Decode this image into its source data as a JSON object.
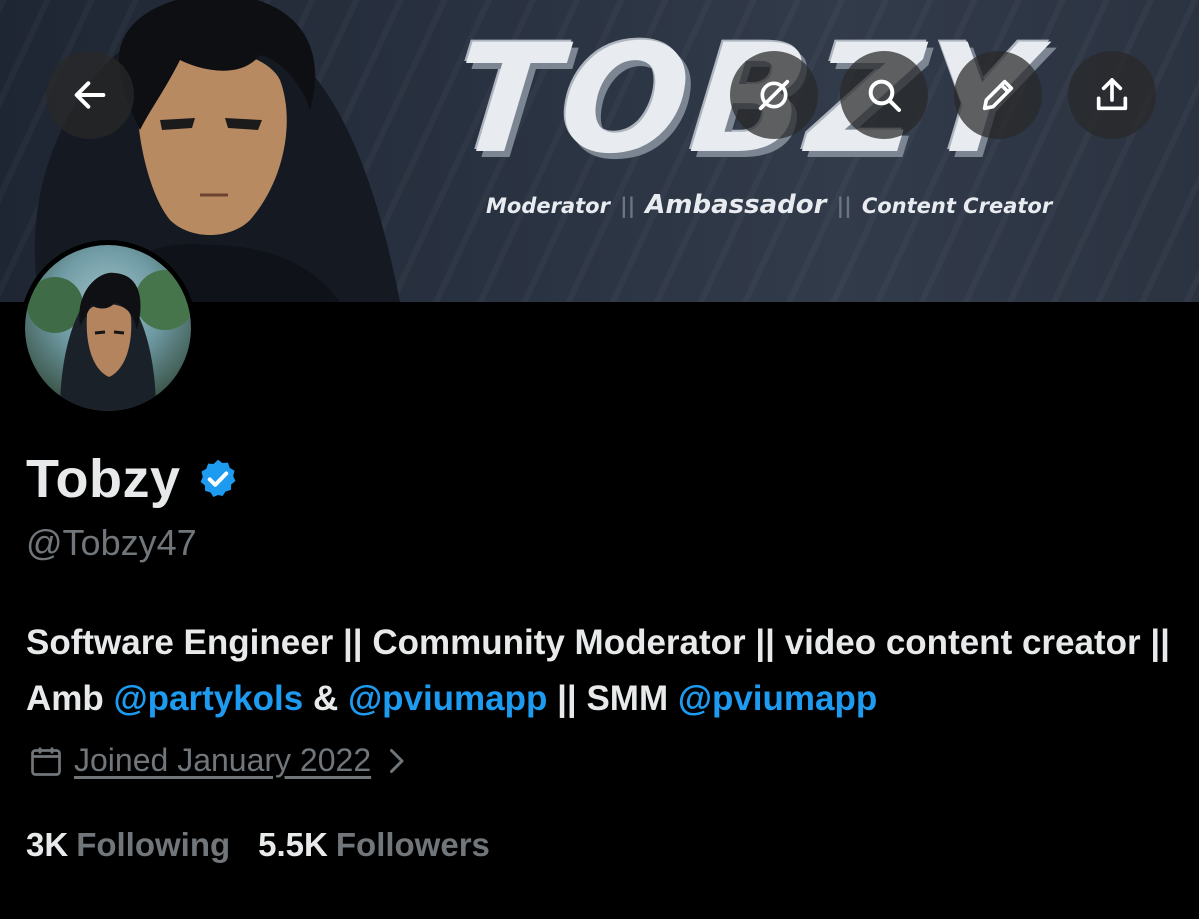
{
  "banner": {
    "logo_text": "TOBZY",
    "tag1": "Moderator",
    "tag2": "Ambassador",
    "tag3": "Content Creator"
  },
  "profile": {
    "name": "Tobzy",
    "handle": "@Tobzy47",
    "bio_parts": [
      {
        "text": "Software Engineer || Community Moderator || video content creator || Amb ",
        "mention": false
      },
      {
        "text": "@partykols",
        "mention": true
      },
      {
        "text": " & ",
        "mention": false
      },
      {
        "text": "@pviumapp",
        "mention": true
      },
      {
        "text": " || SMM ",
        "mention": false
      },
      {
        "text": "@pviumapp",
        "mention": true
      }
    ],
    "joined": "Joined January 2022",
    "following_count": "3K",
    "following_label": "Following",
    "followers_count": "5.5K",
    "followers_label": "Followers"
  },
  "icons": {
    "back": "arrow-left-icon",
    "grok": "grok-icon",
    "search": "search-icon",
    "edit": "pencil-icon",
    "share": "share-icon",
    "verified": "verified-badge-icon",
    "calendar": "calendar-icon"
  },
  "colors": {
    "background": "#000000",
    "text": "#e7e9ea",
    "muted": "#71767b",
    "accent": "#1d9bf0"
  }
}
